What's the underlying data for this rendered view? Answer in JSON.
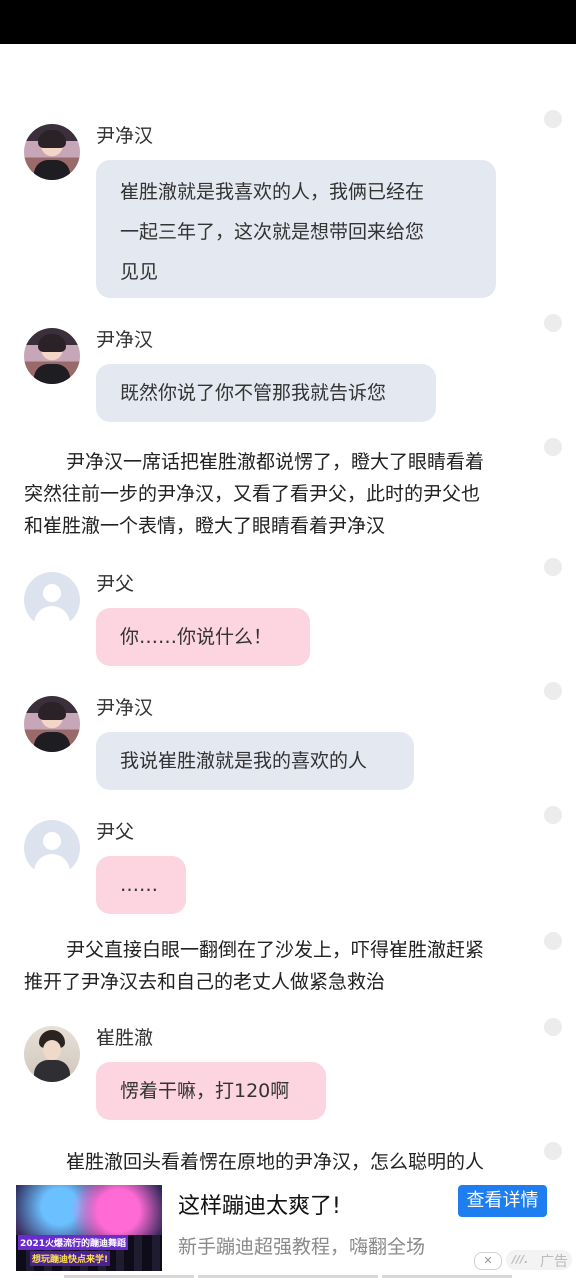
{
  "chat": [
    {
      "speaker": "尹净汉",
      "avatar": "male-avatar",
      "bubble": "gray",
      "lines": [
        "崔胜澈就是我喜欢的人，我俩已经在",
        "一起三年了，这次就是想带回来给您",
        "见见"
      ]
    },
    {
      "speaker": "尹净汉",
      "avatar": "male-avatar",
      "bubble": "gray",
      "lines": [
        "既然你说了你不管那我就告诉您"
      ]
    },
    {
      "narration": [
        "尹净汉一席话把崔胜澈都说愣了，瞪大了眼睛看着",
        "突然往前一步的尹净汉，又看了看尹父，此时的尹父也",
        "和崔胜澈一个表情，瞪大了眼睛看着尹净汉"
      ]
    },
    {
      "speaker": "尹父",
      "avatar": "default-avatar",
      "bubble": "pink",
      "lines": [
        "你……你说什么！"
      ]
    },
    {
      "speaker": "尹净汉",
      "avatar": "male-avatar",
      "bubble": "gray",
      "lines": [
        "我说崔胜澈就是我的喜欢的人"
      ]
    },
    {
      "speaker": "尹父",
      "avatar": "default-avatar",
      "bubble": "pink",
      "lines": [
        "……"
      ]
    },
    {
      "narration": [
        "尹父直接白眼一翻倒在了沙发上，吓得崔胜澈赶紧",
        "推开了尹净汉去和自己的老丈人做紧急救治"
      ]
    },
    {
      "speaker": "崔胜澈",
      "avatar": "male-avatar-2",
      "bubble": "pink",
      "lines": [
        "愣着干嘛，打120啊"
      ]
    },
    {
      "narration": [
        "崔胜澈回头看着愣在原地的尹净汉，怎么聪明的人"
      ]
    }
  ],
  "ad": {
    "title": "这样蹦迪太爽了!",
    "subtitle": "新手蹦迪超强教程，嗨翻全场",
    "button": "查看详情",
    "tag": "广告",
    "tag_mark": "///.",
    "close": "✕",
    "image_caption_1": "2021火爆流行的蹦迪舞蹈",
    "image_caption_2": "想玩蹦迪快点来学!"
  },
  "colors": {
    "bubble_gray": "#e4e9f1",
    "bubble_pink": "#fdd5e0",
    "ad_button": "#1e7ef0"
  }
}
